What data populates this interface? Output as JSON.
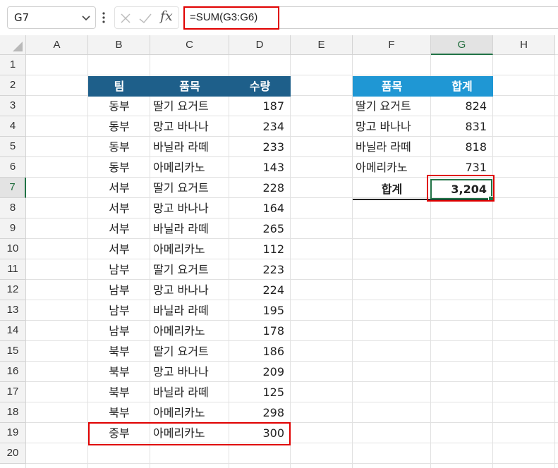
{
  "formula_bar": {
    "name_box": "G7",
    "fx_label": "fx",
    "formula": "=SUM(G3:G6)"
  },
  "columns": [
    "A",
    "B",
    "C",
    "D",
    "E",
    "F",
    "G",
    "H"
  ],
  "rows": [
    "1",
    "2",
    "3",
    "4",
    "5",
    "6",
    "7",
    "8",
    "9",
    "10",
    "11",
    "12",
    "13",
    "14",
    "15",
    "16",
    "17",
    "18",
    "19",
    "20"
  ],
  "table1": {
    "headers": [
      "팀",
      "품목",
      "수량"
    ],
    "rows": [
      [
        "동부",
        "딸기 요거트",
        "187"
      ],
      [
        "동부",
        "망고 바나나",
        "234"
      ],
      [
        "동부",
        "바닐라 라떼",
        "233"
      ],
      [
        "동부",
        "아메리카노",
        "143"
      ],
      [
        "서부",
        "딸기 요거트",
        "228"
      ],
      [
        "서부",
        "망고 바나나",
        "164"
      ],
      [
        "서부",
        "바닐라 라떼",
        "265"
      ],
      [
        "서부",
        "아메리카노",
        "112"
      ],
      [
        "남부",
        "딸기 요거트",
        "223"
      ],
      [
        "남부",
        "망고 바나나",
        "224"
      ],
      [
        "남부",
        "바닐라 라떼",
        "195"
      ],
      [
        "남부",
        "아메리카노",
        "178"
      ],
      [
        "북부",
        "딸기 요거트",
        "186"
      ],
      [
        "북부",
        "망고 바나나",
        "209"
      ],
      [
        "북부",
        "바닐라 라떼",
        "125"
      ],
      [
        "북부",
        "아메리카노",
        "298"
      ],
      [
        "중부",
        "아메리카노",
        "300"
      ]
    ]
  },
  "table2": {
    "headers": [
      "품목",
      "합계"
    ],
    "rows": [
      [
        "딸기 요거트",
        "824"
      ],
      [
        "망고 바나나",
        "831"
      ],
      [
        "바닐라 라떼",
        "818"
      ],
      [
        "아메리카노",
        "731"
      ]
    ],
    "total_label": "합계",
    "total_value": "3,204"
  },
  "selected_cell": "G7",
  "colors": {
    "header_dark": "#1e5f8a",
    "header_light": "#1f97d4",
    "highlight": "#e00000",
    "selection": "#217346"
  }
}
